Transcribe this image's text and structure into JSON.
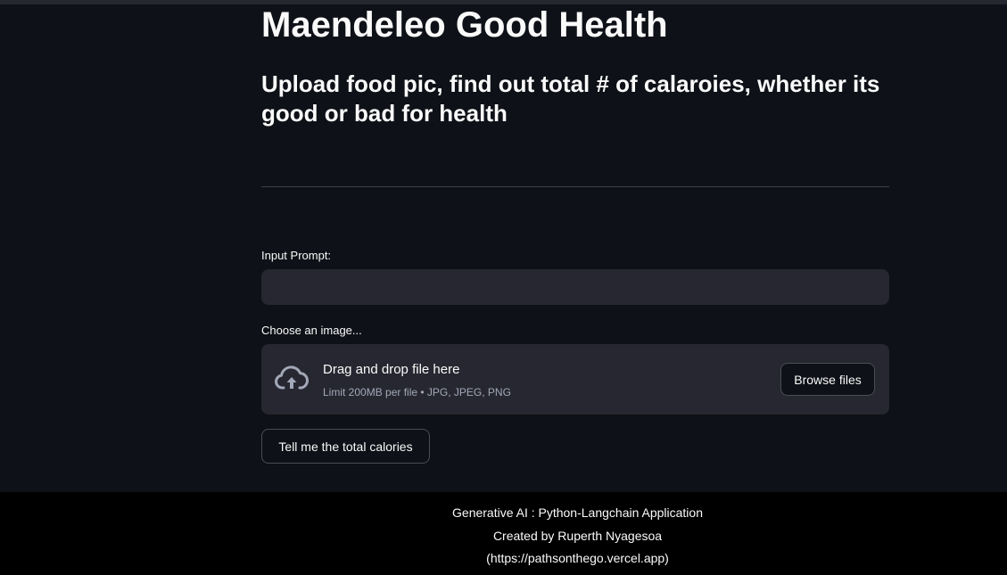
{
  "app": {
    "title": "Maendeleo Good Health",
    "subtitle": "Upload food pic, find out total # of calaroies, whether its good or bad for health"
  },
  "prompt": {
    "label": "Input Prompt:",
    "value": "",
    "placeholder": ""
  },
  "uploader": {
    "label": "Choose an image...",
    "drop_title": "Drag and drop file here",
    "drop_limit": "Limit 200MB per file • JPG, JPEG, PNG",
    "browse_label": "Browse files",
    "icon": "cloud-upload-icon"
  },
  "actions": {
    "submit_label": "Tell me the total calories"
  },
  "footer": {
    "line1": "Generative AI : Python-Langchain Application",
    "line2": "Created by Ruperth Nyagesoa",
    "line3": "(https://pathsonthego.vercel.app)"
  },
  "colors": {
    "background": "#0e1117",
    "widget": "#262730",
    "footer": "#000000",
    "text": "#fafafa"
  }
}
